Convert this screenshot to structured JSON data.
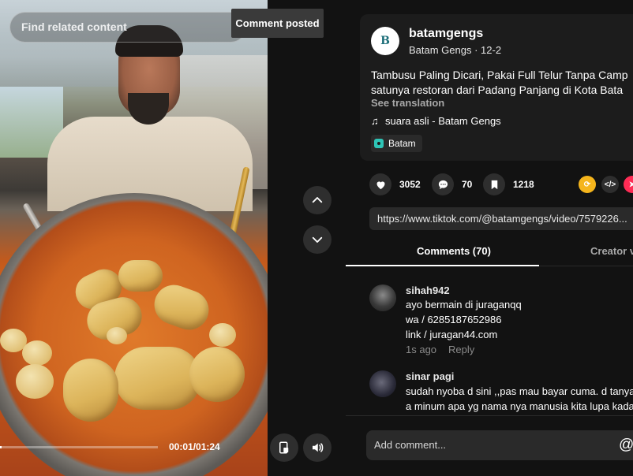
{
  "video": {
    "find_related": "Find related content",
    "toast": "Comment posted",
    "progress_fraction": 0.01,
    "time": "00:01/01:24"
  },
  "post": {
    "avatar_text": "B",
    "username": "batamgengs",
    "subline": "Batam Gengs · 12-2",
    "description_line1": "Tambusu Paling Dicari, Pakai Full Telur Tanpa Camp",
    "description_line2": "satunya restoran dari Padang Panjang di Kota Bata",
    "see_translation": "See translation",
    "music": "suara asli - Batam Gengs",
    "location": "Batam"
  },
  "actions": {
    "likes": "3052",
    "comments": "70",
    "saves": "1218"
  },
  "share": {
    "embed_label": "</>"
  },
  "url": "https://www.tiktok.com/@batamgengs/video/7579226...",
  "tabs": {
    "comments": "Comments (70)",
    "creator": "Creator v"
  },
  "comments": [
    {
      "user": "sihah942",
      "lines": [
        "ayo bermain di juraganqq",
        "wa / 6285187652986",
        "link / juragan44.com"
      ],
      "time": "1s ago",
      "reply": "Reply"
    },
    {
      "user": "sinar pagi",
      "lines": [
        "sudah nyoba d sini ,,pas mau bayar cuma. d tanya",
        "a minum apa yg nama nya manusia kita lupa kadan"
      ]
    }
  ],
  "composer": {
    "placeholder": "Add comment...",
    "at": "@"
  },
  "colors": {
    "background": "#121212",
    "card": "#1c1c1c",
    "location_pin": "#2ec4b6",
    "share_repost": "#f5b51c",
    "share_red": "#fe2c55"
  }
}
